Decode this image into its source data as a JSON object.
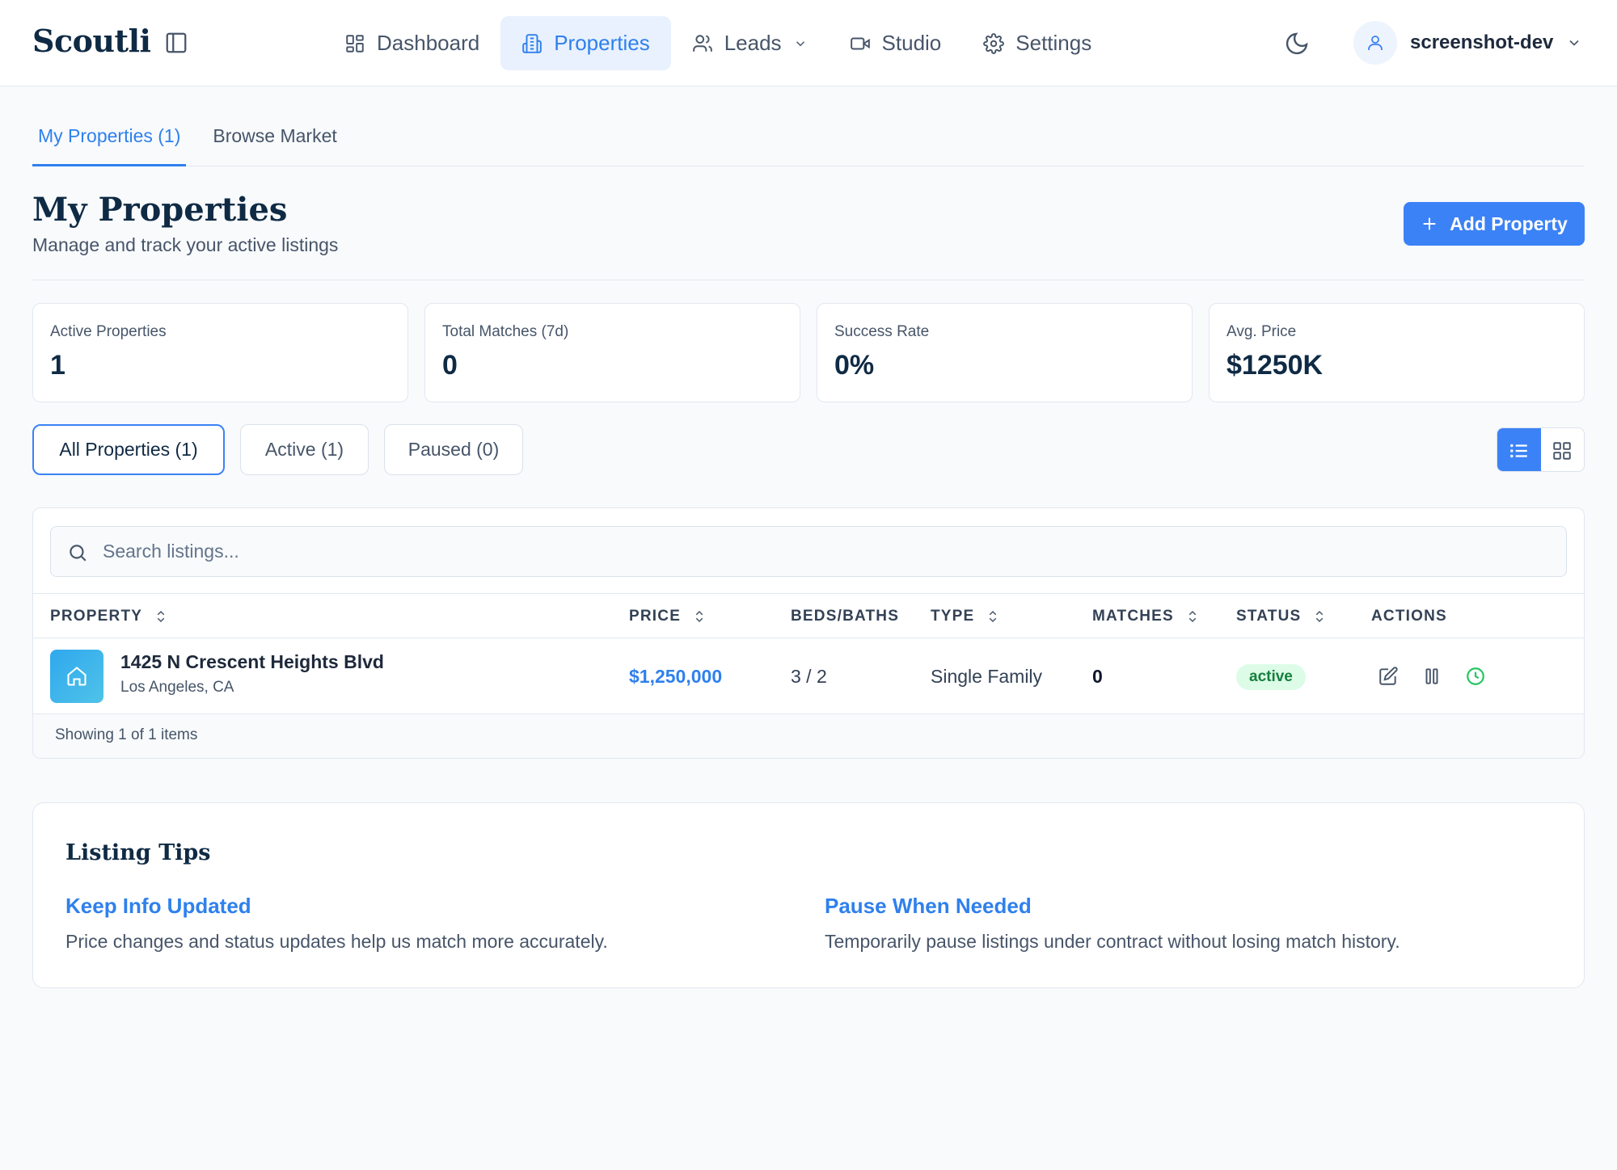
{
  "app": {
    "brand": "Scoutli"
  },
  "nav": {
    "items": [
      {
        "label": "Dashboard",
        "icon": "dashboard-icon"
      },
      {
        "label": "Properties",
        "icon": "building-icon",
        "active": true
      },
      {
        "label": "Leads",
        "icon": "users-icon",
        "has_dropdown": true
      },
      {
        "label": "Studio",
        "icon": "video-icon"
      },
      {
        "label": "Settings",
        "icon": "gear-icon"
      }
    ],
    "user_name": "screenshot-dev"
  },
  "tabs": [
    {
      "label": "My Properties (1)",
      "active": true
    },
    {
      "label": "Browse Market",
      "active": false
    }
  ],
  "header": {
    "title": "My Properties",
    "subtitle": "Manage and track your active listings",
    "add_button": "Add Property"
  },
  "stats": [
    {
      "label": "Active Properties",
      "value": "1"
    },
    {
      "label": "Total Matches (7d)",
      "value": "0"
    },
    {
      "label": "Success Rate",
      "value": "0%"
    },
    {
      "label": "Avg. Price",
      "value": "$1250K"
    }
  ],
  "filters": [
    {
      "label": "All Properties (1)",
      "active": true
    },
    {
      "label": "Active (1)",
      "active": false
    },
    {
      "label": "Paused (0)",
      "active": false
    }
  ],
  "view_mode": "list",
  "search": {
    "placeholder": "Search listings...",
    "value": ""
  },
  "table": {
    "columns": [
      {
        "label": "PROPERTY",
        "sortable": true
      },
      {
        "label": "PRICE",
        "sortable": true
      },
      {
        "label": "BEDS/BATHS",
        "sortable": false
      },
      {
        "label": "TYPE",
        "sortable": true
      },
      {
        "label": "MATCHES",
        "sortable": true
      },
      {
        "label": "STATUS",
        "sortable": true
      },
      {
        "label": "ACTIONS",
        "sortable": false
      }
    ],
    "rows": [
      {
        "address": "1425 N Crescent Heights Blvd",
        "city": "Los Angeles, CA",
        "price": "$1,250,000",
        "beds_baths": "3 / 2",
        "type": "Single Family",
        "matches": "0",
        "status": "active"
      }
    ],
    "footer": "Showing 1 of 1 items"
  },
  "tips": {
    "title": "Listing Tips",
    "items": [
      {
        "heading": "Keep Info Updated",
        "body": "Price changes and status updates help us match more accurately."
      },
      {
        "heading": "Pause When Needed",
        "body": "Temporarily pause listings under contract without losing match history."
      }
    ]
  },
  "colors": {
    "accent": "#3b82f6",
    "link": "#2f80ed",
    "navy": "#0f2a44",
    "status_active_bg": "#dcfce7",
    "status_active_text": "#15803d"
  }
}
